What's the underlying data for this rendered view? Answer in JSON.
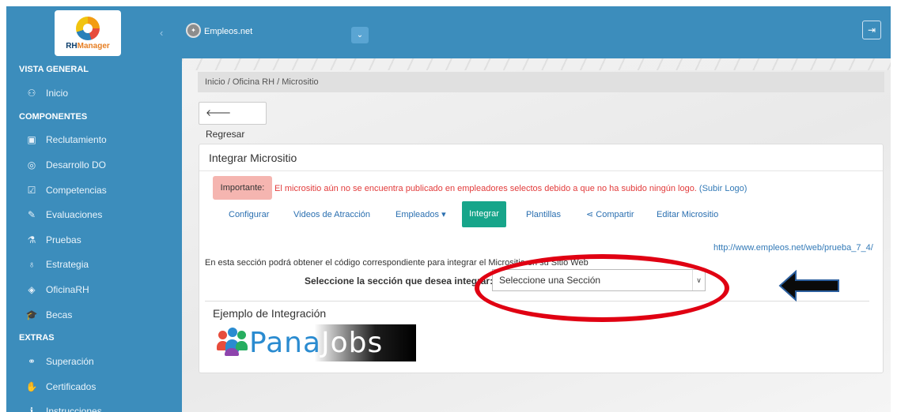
{
  "sidebar": {
    "logo_text_rh": "RH",
    "logo_text_manager": "Manager",
    "toggle": "‹",
    "sections": [
      {
        "header": "VISTA GENERAL",
        "items": [
          {
            "label": "Inicio",
            "icon": "dashboard-icon",
            "glyph": "⚇"
          }
        ]
      },
      {
        "header": "COMPONENTES",
        "items": [
          {
            "label": "Reclutamiento",
            "icon": "calendar-icon",
            "glyph": "▣"
          },
          {
            "label": "Desarrollo DO",
            "icon": "eye-icon",
            "glyph": "◎"
          },
          {
            "label": "Competencias",
            "icon": "check-square-icon",
            "glyph": "☑"
          },
          {
            "label": "Evaluaciones",
            "icon": "edit-icon",
            "glyph": "✎"
          },
          {
            "label": "Pruebas",
            "icon": "flask-icon",
            "glyph": "⚗"
          },
          {
            "label": "Estrategia",
            "icon": "lightbulb-icon",
            "glyph": "♁"
          },
          {
            "label": "OficinaRH",
            "icon": "diamond-icon",
            "glyph": "◈"
          },
          {
            "label": "Becas",
            "icon": "graduation-cap-icon",
            "glyph": "🎓"
          }
        ]
      },
      {
        "header": "EXTRAS",
        "items": [
          {
            "label": "Superación",
            "icon": "users-icon",
            "glyph": "⚭"
          },
          {
            "label": "Certificados",
            "icon": "hand-icon",
            "glyph": "✋"
          },
          {
            "label": "Instrucciones",
            "icon": "info-icon",
            "glyph": "ℹ"
          }
        ]
      }
    ]
  },
  "header": {
    "site_name": "Empleos.net",
    "dropdown_glyph": "⌄",
    "logout_glyph": "⇥"
  },
  "breadcrumb": "Inicio / Oficina RH / Micrositio",
  "back_button": "🡐 Regresar",
  "panel": {
    "title": "Integrar Micrositio",
    "alert_label": "Importante:",
    "alert_text": "El micrositio aún no se encuentra publicado en empleadores selectos debido a que no ha subido ningún logo. ",
    "alert_link": "(Subir Logo)",
    "tabs": [
      {
        "label": "Configurar"
      },
      {
        "label": "Videos de Atracción"
      },
      {
        "label": "Empleados ▾"
      },
      {
        "label": "Integrar"
      },
      {
        "label": "Plantillas"
      },
      {
        "label": "⋖ Compartir"
      },
      {
        "label": "Editar Micrositio"
      }
    ],
    "active_tab": "Integrar",
    "url": "http://www.empleos.net/web/prueba_7_4/",
    "section_info": "En esta sección podrá obtener el código correspondiente para integrar el Micrositio en su Sitio Web",
    "select_label": "Seleccione la sección que desea integrar:",
    "select_value": "Seleccione una Sección",
    "example_title": "Ejemplo de Integración",
    "panajobs_pana": "Pana",
    "panajobs_jobs": "Jobs"
  },
  "colors": {
    "sidebar": "#3c8dbc",
    "active_tab": "#17a58a",
    "alert_text": "#e23b3b",
    "annotation_ellipse": "#e00012",
    "annotation_arrow": "#0a0a0a"
  }
}
